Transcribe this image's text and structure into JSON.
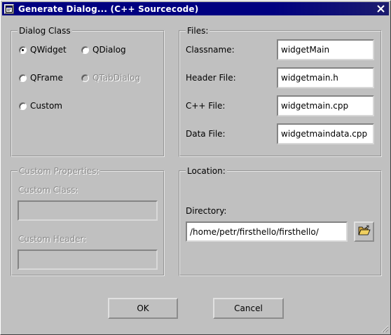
{
  "window": {
    "title": "Generate Dialog... (C++ Sourcecode)"
  },
  "dialog_class": {
    "legend": "Dialog Class",
    "options": [
      {
        "label": "QWidget",
        "checked": true,
        "enabled": true
      },
      {
        "label": "QDialog",
        "checked": false,
        "enabled": true
      },
      {
        "label": "QFrame",
        "checked": false,
        "enabled": true
      },
      {
        "label": "QTabDialog",
        "checked": false,
        "enabled": false
      },
      {
        "label": "Custom",
        "checked": false,
        "enabled": true
      }
    ]
  },
  "files": {
    "legend": "Files:",
    "classname_label": "Classname:",
    "classname_value": "widgetMain",
    "header_label": "Header File:",
    "header_value": "widgetmain.h",
    "cpp_label": "C++ File:",
    "cpp_value": "widgetmain.cpp",
    "data_label": "Data File:",
    "data_value": "widgetmaindata.cpp"
  },
  "custom_properties": {
    "legend": "Custom Properties:",
    "class_label": "Custom Class:",
    "class_value": "",
    "header_label": "Custom Header:",
    "header_value": ""
  },
  "location": {
    "legend": "Location:",
    "directory_label": "Directory:",
    "directory_value": "/home/petr/firsthello/firsthello/"
  },
  "buttons": {
    "ok": "OK",
    "cancel": "Cancel"
  },
  "icons": {
    "window_icon": "dialog-window-icon",
    "close": "close-icon",
    "browse": "folder-open-icon"
  }
}
